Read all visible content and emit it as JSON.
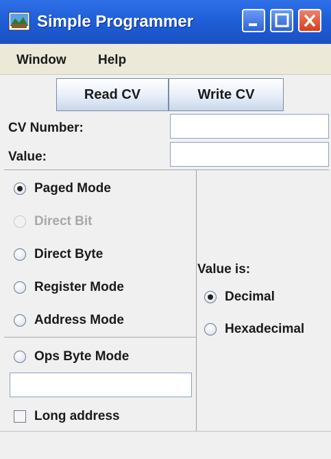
{
  "window": {
    "title": "Simple Programmer"
  },
  "menu": {
    "items": [
      "Window",
      "Help"
    ]
  },
  "toolbar": {
    "read_label": "Read CV",
    "write_label": "Write CV"
  },
  "fields": {
    "cv_number_label": "CV Number:",
    "cv_number_value": "",
    "value_label": "Value:",
    "value_value": ""
  },
  "modes": {
    "paged": "Paged Mode",
    "direct_bit": "Direct Bit",
    "direct_byte": "Direct Byte",
    "register": "Register Mode",
    "address": "Address Mode",
    "ops_byte": "Ops Byte Mode",
    "ops_address_value": "",
    "long_address": "Long address"
  },
  "value_is": {
    "label": "Value is:",
    "decimal": "Decimal",
    "hexadecimal": "Hexadecimal"
  }
}
